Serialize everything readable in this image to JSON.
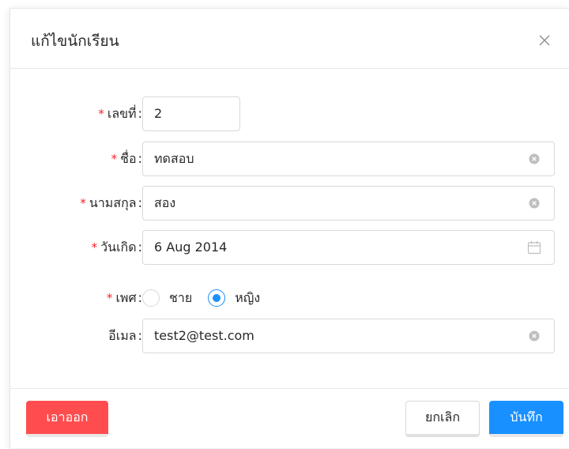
{
  "dialog": {
    "title": "แก้ไขนักเรียน"
  },
  "form": {
    "required_mark": "*",
    "colon": ":",
    "number": {
      "label": "เลขที่",
      "value": "2"
    },
    "first_name": {
      "label": "ชื่อ",
      "value": "ทดสอบ"
    },
    "last_name": {
      "label": "นามสกุล",
      "value": "สอง"
    },
    "birth_date": {
      "label": "วันเกิด",
      "value": "6 Aug 2014"
    },
    "gender": {
      "label": "เพศ",
      "options": [
        "ชาย",
        "หญิง"
      ],
      "selected": "หญิง"
    },
    "email": {
      "label": "อีเมล",
      "value": "test2@test.com"
    }
  },
  "footer": {
    "delete_label": "เอาออก",
    "cancel_label": "ยกเลิก",
    "save_label": "บันทึก"
  },
  "colors": {
    "primary": "#1890ff",
    "danger": "#ff4d4f",
    "required": "#f5222d"
  },
  "icons": {
    "close": "close-icon",
    "clear": "clear-circle-icon",
    "calendar": "calendar-icon"
  }
}
